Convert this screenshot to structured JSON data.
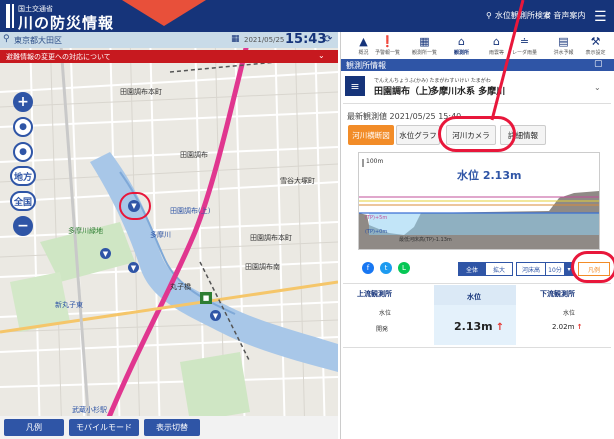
{
  "header": {
    "logo_small": "国土交通省",
    "logo_title": "川の防災情報",
    "nav": [
      {
        "icon": "search-icon",
        "label": "水位観測所検索"
      },
      {
        "icon": "headset-icon",
        "label": "音声案内"
      }
    ]
  },
  "map": {
    "search_text": "東京都大田区",
    "date": "2021/05/25",
    "time": "15:43",
    "alert": "避難情報の変更への対応について",
    "controls": [
      "地方",
      "全国"
    ],
    "labels": {
      "l1": "田園調布本町",
      "l2": "田園調布",
      "l3": "多摩川緑地",
      "l4": "多摩川緑地",
      "l5": "多摩川",
      "l6": "田園調布(上)",
      "l7": "新丸子東",
      "l8": "丸子橋",
      "l9": "田園調布南",
      "l10": "雪谷大塚町",
      "l11": "田園調布本町",
      "l12": "武蔵小杉駅"
    },
    "bottom_buttons": [
      "凡例",
      "モバイルモード",
      "表示切替"
    ]
  },
  "panel": {
    "tabs": [
      {
        "icon": "warning-icon",
        "label": "概況"
      },
      {
        "icon": "exclaim-icon",
        "label": "予警報一覧"
      },
      {
        "icon": "building-icon",
        "label": "観測所一覧"
      },
      {
        "icon": "home-icon",
        "label": "観測所"
      },
      {
        "icon": "house-icon",
        "label": "雨雲等"
      },
      {
        "icon": "radar-icon",
        "label": "レーダ雨量"
      },
      {
        "icon": "shop-icon",
        "label": "洪水予報"
      },
      {
        "icon": "wrench-icon",
        "label": "表示設定"
      }
    ],
    "section_title": "観測所情報",
    "station": {
      "ruby": "でんえんちょうふ(かみ)  たまがわすいけい  たまがわ",
      "name": "田園調布（上）",
      "river": "多摩川水系 多摩川"
    },
    "latest_time": "最新観測値 2021/05/25 15:40",
    "info_tabs": [
      "河川横断図",
      "水位グラフ",
      "河川カメラ",
      "詳細情報"
    ],
    "chart": {
      "scale_label": "100m",
      "water_level_label": "水位 2.13m",
      "left_labels": [
        "(TP)+5m",
        "(TP)+0m"
      ],
      "bottom_label": "最低河床高(TP)-1.13m"
    },
    "controls": [
      "全体",
      "拡大",
      "河床高",
      "10分",
      "凡例"
    ],
    "obs": {
      "upstream_head": "上流観測所",
      "upstream_sub": "水位",
      "upstream_val": "開発",
      "center_head": "水位",
      "center_val": "2.13m",
      "downstream_head": "下流観測所",
      "downstream_sub": "水位",
      "downstream_val": "2.02m"
    }
  },
  "colors": {
    "header": "#16347a",
    "accent": "#2f55a6",
    "alert": "#c7191f",
    "callout": "#e8173b",
    "active_tab": "#f28c28"
  }
}
